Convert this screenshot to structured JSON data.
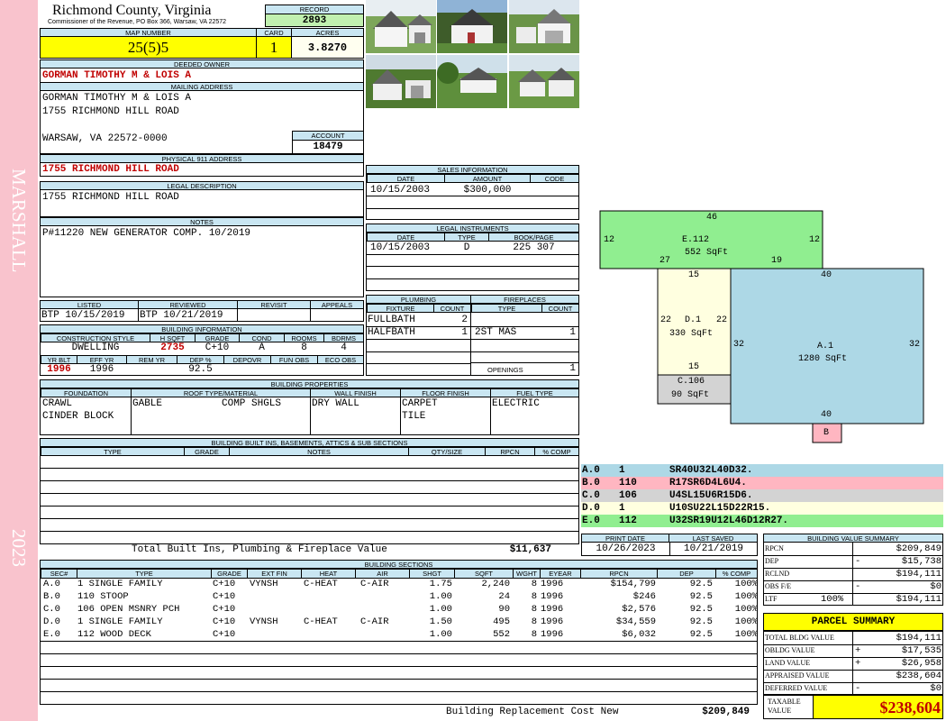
{
  "sidebar": {
    "top_text": "MARSHALL",
    "bottom_text": "2023"
  },
  "header": {
    "county": "Richmond County, Virginia",
    "commissioner": "Commissioner of the Revenue, PO Box 366, Warsaw, VA 22572",
    "record_label": "RECORD",
    "record": "2893",
    "map_number_label": "MAP NUMBER",
    "map_number": "25(5)5",
    "card_label": "CARD",
    "card": "1",
    "acres_label": "ACRES",
    "acres": "3.8270"
  },
  "owner": {
    "label": "DEEDED OWNER",
    "name": "GORMAN TIMOTHY M & LOIS A",
    "mailing_label": "MAILING ADDRESS",
    "mailing_lines": [
      "GORMAN TIMOTHY M & LOIS A",
      "1755 RICHMOND HILL ROAD",
      "WARSAW, VA 22572-0000"
    ],
    "account_label": "ACCOUNT",
    "account": "18479",
    "physical_label": "PHYSICAL 911 ADDRESS",
    "physical": "1755 RICHMOND HILL ROAD",
    "legal_label": "LEGAL DESCRIPTION",
    "legal": "1755 RICHMOND HILL ROAD",
    "notes_label": "NOTES",
    "notes": "P#11220 NEW GENERATOR COMP. 10/2019"
  },
  "review": {
    "listed_label": "LISTED",
    "listed": "BTP 10/15/2019",
    "reviewed_label": "REVIEWED",
    "reviewed": "BTP 10/21/2019",
    "revisit_label": "REVISIT",
    "appeals_label": "APPEALS"
  },
  "building_info": {
    "label": "BUILDING INFORMATION",
    "headers": [
      "CONSTRUCTION STYLE",
      "H SQFT",
      "GRADE",
      "COND",
      "ROOMS",
      "BDRMS"
    ],
    "values": [
      "DWELLING",
      "2735",
      "C+10",
      "A",
      "8",
      "4"
    ],
    "headers2": [
      "YR BLT",
      "EFF YR",
      "REM YR",
      "DEP %",
      "DEPOVR",
      "FUN OBS",
      "ECO OBS"
    ],
    "values2": [
      "1996",
      "1996",
      "",
      "92.5",
      "",
      "",
      ""
    ]
  },
  "sales": {
    "label": "SALES INFORMATION",
    "headers": [
      "DATE",
      "AMOUNT",
      "CODE"
    ],
    "rows": [
      [
        "10/15/2003",
        "$300,000",
        ""
      ]
    ]
  },
  "legal_instruments": {
    "label": "LEGAL INSTRUMENTS",
    "headers": [
      "DATE",
      "TYPE",
      "BOOK/PAGE"
    ],
    "rows": [
      [
        "10/15/2003",
        "D",
        "225 307"
      ]
    ]
  },
  "plumbing": {
    "label": "PLUMBING",
    "headers": [
      "FIXTURE",
      "COUNT"
    ],
    "rows": [
      [
        "FULLBATH",
        "2"
      ],
      [
        "HALFBATH",
        "1"
      ]
    ]
  },
  "fireplaces": {
    "label": "FIREPLACES",
    "headers": [
      "TYPE",
      "COUNT"
    ],
    "rows": [
      [
        "2ST MAS",
        "1"
      ]
    ],
    "openings_label": "OPENINGS",
    "openings": "1"
  },
  "properties": {
    "label": "BUILDING PROPERTIES",
    "headers": [
      "FOUNDATION",
      "ROOF TYPE/MATERIAL",
      "WALL FINISH",
      "FLOOR FINISH",
      "FUEL TYPE"
    ],
    "foundation": [
      "CRAWL",
      "CINDER BLOCK"
    ],
    "roof_type": "GABLE",
    "roof_material": "COMP SHGLS",
    "wall": "DRY WALL",
    "floor": [
      "CARPET",
      "TILE"
    ],
    "fuel": "ELECTRIC"
  },
  "builtins": {
    "label": "BUILDING BUILT INS, BASEMENTS, ATTICS & SUB SECTIONS",
    "headers": [
      "TYPE",
      "GRADE",
      "NOTES",
      "QTY/SIZE",
      "RPCN",
      "% COMP"
    ],
    "total_label": "Total Built Ins, Plumbing & Fireplace Value",
    "total": "$11,637"
  },
  "segments": [
    {
      "code": "A.0",
      "num": "1",
      "path": "SR40U32L40D32.",
      "color": "#add8e6"
    },
    {
      "code": "B.0",
      "num": "110",
      "path": "R17SR6D4L6U4.",
      "color": "#ffb6c1"
    },
    {
      "code": "C.0",
      "num": "106",
      "path": "U4SL15U6R15D6.",
      "color": "#d3d3d3"
    },
    {
      "code": "D.0",
      "num": "1",
      "path": "U10SU22L15D22R15.",
      "color": "#ffffe0"
    },
    {
      "code": "E.0",
      "num": "112",
      "path": "U32SR19U12L46D12R27.",
      "color": "#90ee90"
    }
  ],
  "sketch": {
    "E": {
      "label": "E.112",
      "area": "552 SqFt",
      "top": "46",
      "left": "12",
      "right": "12",
      "bl": "27",
      "br": "19"
    },
    "D": {
      "label": "D.1",
      "area": "330 SqFt",
      "top": "15",
      "left": "22",
      "right": "22",
      "bottom": "15"
    },
    "A": {
      "label": "A.1",
      "area": "1280 SqFt",
      "top": "40",
      "left": "32",
      "right": "32",
      "bottom": "40"
    },
    "C": {
      "label": "C.106",
      "area": "90 SqFt"
    },
    "B": {
      "label": "B"
    }
  },
  "dates": {
    "print_label": "PRINT DATE",
    "print": "10/26/2023",
    "saved_label": "LAST SAVED",
    "saved": "10/21/2019"
  },
  "sections": {
    "label": "BUILDING SECTIONS",
    "headers": [
      "SEC#",
      "TYPE",
      "GRADE",
      "EXT FIN",
      "HEAT",
      "AIR",
      "SHGT",
      "SQFT",
      "WGHT",
      "EYEAR",
      "RPCN",
      "DEP",
      "% COMP"
    ],
    "rows": [
      [
        "A.0",
        "1 SINGLE FAMILY",
        "C+10",
        "VYNSH",
        "C-HEAT",
        "C-AIR",
        "1.75",
        "2,240",
        "8",
        "1996",
        "$154,799",
        "92.5",
        "100%"
      ],
      [
        "B.0",
        "110 STOOP",
        "C+10",
        "",
        "",
        "",
        "1.00",
        "24",
        "8",
        "1996",
        "$246",
        "92.5",
        "100%"
      ],
      [
        "C.0",
        "106 OPEN MSNRY PCH",
        "C+10",
        "",
        "",
        "",
        "1.00",
        "90",
        "8",
        "1996",
        "$2,576",
        "92.5",
        "100%"
      ],
      [
        "D.0",
        "1 SINGLE FAMILY",
        "C+10",
        "VYNSH",
        "C-HEAT",
        "C-AIR",
        "1.50",
        "495",
        "8",
        "1996",
        "$34,559",
        "92.5",
        "100%"
      ],
      [
        "E.0",
        "112 WOOD DECK",
        "C+10",
        "",
        "",
        "",
        "1.00",
        "552",
        "8",
        "1996",
        "$6,032",
        "92.5",
        "100%"
      ]
    ],
    "total_label": "Building Replacement Cost New",
    "total": "$209,849"
  },
  "value_summary": {
    "label": "BUILDING VALUE SUMMARY",
    "rows": [
      {
        "label": "RPCN",
        "op": "",
        "value": "$209,849"
      },
      {
        "label": "DEP",
        "op": "-",
        "value": "$15,738"
      },
      {
        "label": "RCLND",
        "op": "",
        "value": "$194,111"
      },
      {
        "label": "OBS F/E",
        "op": "-",
        "value": "$0"
      },
      {
        "label": "LTF",
        "op": "100%",
        "value": "$194,111"
      }
    ]
  },
  "parcel": {
    "label": "PARCEL SUMMARY",
    "rows": [
      {
        "label": "TOTAL BLDG VALUE",
        "op": "",
        "value": "$194,111"
      },
      {
        "label": "OBLDG VALUE",
        "op": "+",
        "value": "$17,535"
      },
      {
        "label": "LAND VALUE",
        "op": "+",
        "value": "$26,958"
      },
      {
        "label": "APPRAISED VALUE",
        "op": "",
        "value": "$238,604"
      },
      {
        "label": "DEFERRED VALUE",
        "op": "-",
        "value": "$0"
      }
    ],
    "taxable_label": "TAXABLE VALUE",
    "taxable": "$238,604"
  }
}
